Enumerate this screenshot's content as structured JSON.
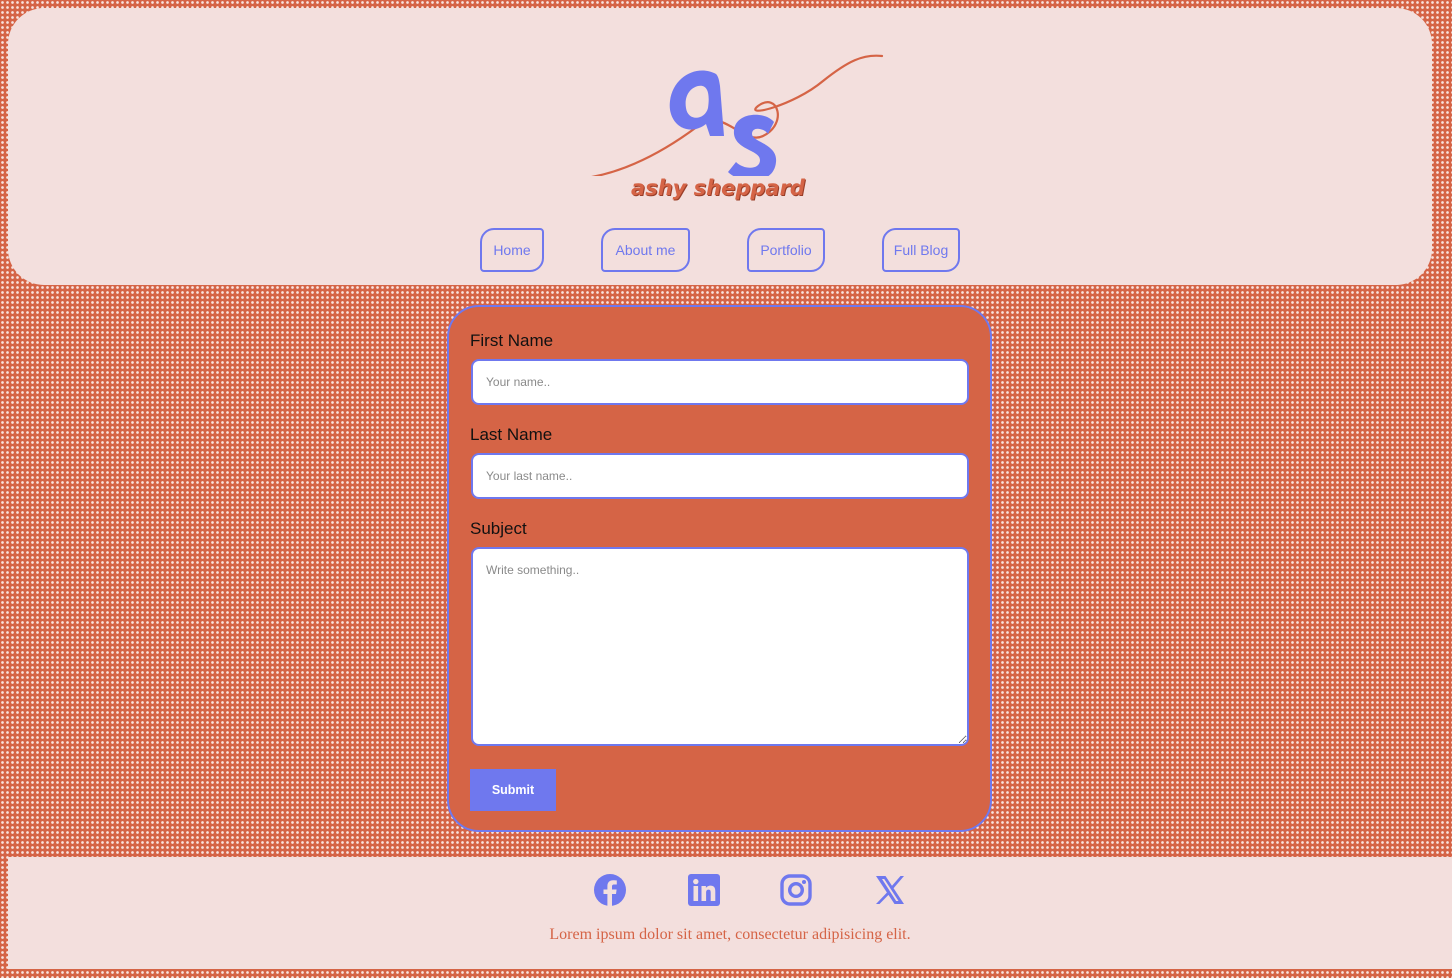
{
  "brand": {
    "monogram": "as",
    "name": "ashy sheppard"
  },
  "nav": {
    "items": [
      {
        "label": "Home"
      },
      {
        "label": "About me"
      },
      {
        "label": "Portfolio"
      },
      {
        "label": "Full Blog"
      }
    ]
  },
  "form": {
    "first_name_label": "First Name",
    "first_name_placeholder": "Your name..",
    "last_name_label": "Last Name",
    "last_name_placeholder": "Your last name..",
    "subject_label": "Subject",
    "subject_placeholder": "Write something..",
    "submit_label": "Submit"
  },
  "footer": {
    "social": [
      {
        "icon": "facebook-icon"
      },
      {
        "icon": "linkedin-icon"
      },
      {
        "icon": "instagram-icon"
      },
      {
        "icon": "x-twitter-icon"
      }
    ],
    "text": "Lorem ipsum dolor sit amet, consectetur adipisicing elit."
  },
  "colors": {
    "background": "#d56446",
    "panel": "#f3dfdd",
    "accent": "#6f78ee",
    "white": "#ffffff"
  }
}
